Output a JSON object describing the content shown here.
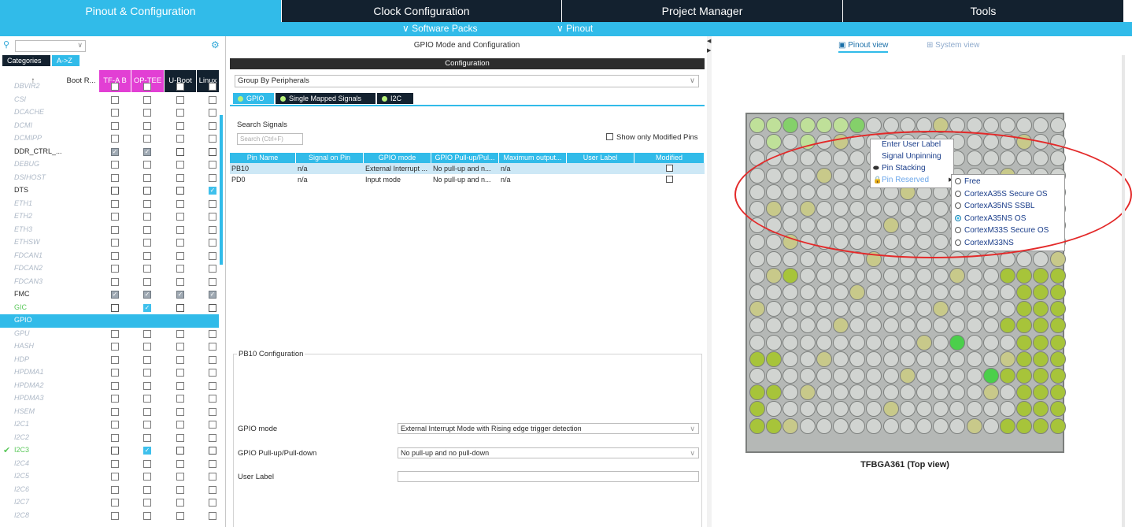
{
  "top_tabs": [
    "Pinout & Configuration",
    "Clock Configuration",
    "Project Manager",
    "Tools"
  ],
  "sub_menu": {
    "software_packs": "Software Packs",
    "pinout": "Pinout"
  },
  "left": {
    "category_tabs": [
      "Categories",
      "A->Z"
    ],
    "columns": [
      "Boot R...",
      "TF-A B",
      "OP-TEE",
      "U-Boot",
      "Linux"
    ],
    "rows": [
      {
        "name": "DBVIR2",
        "enabled": false,
        "checks": [
          "off",
          "off",
          "off",
          "off"
        ]
      },
      {
        "name": "CSI",
        "enabled": false,
        "checks": [
          "off",
          "off",
          "off",
          "off"
        ]
      },
      {
        "name": "DCACHE",
        "enabled": false,
        "checks": [
          "off",
          "off",
          "off",
          "off"
        ]
      },
      {
        "name": "DCMI",
        "enabled": false,
        "checks": [
          "off",
          "off",
          "off",
          "off"
        ]
      },
      {
        "name": "DCMIPP",
        "enabled": false,
        "checks": [
          "off",
          "off",
          "off",
          "off"
        ]
      },
      {
        "name": "DDR_CTRL_...",
        "enabled": true,
        "checks": [
          "on",
          "on",
          "off",
          "off"
        ]
      },
      {
        "name": "DEBUG",
        "enabled": false,
        "checks": [
          "off",
          "off",
          "off",
          "off"
        ]
      },
      {
        "name": "DSIHOST",
        "enabled": false,
        "checks": [
          "off",
          "off",
          "off",
          "off"
        ]
      },
      {
        "name": "DTS",
        "enabled": true,
        "checks": [
          "off",
          "off",
          "off",
          "blue"
        ]
      },
      {
        "name": "ETH1",
        "enabled": false,
        "checks": [
          "off",
          "off",
          "off",
          "off"
        ]
      },
      {
        "name": "ETH2",
        "enabled": false,
        "checks": [
          "off",
          "off",
          "off",
          "off"
        ]
      },
      {
        "name": "ETH3",
        "enabled": false,
        "checks": [
          "off",
          "off",
          "off",
          "off"
        ]
      },
      {
        "name": "ETHSW",
        "enabled": false,
        "checks": [
          "off",
          "off",
          "off",
          "off"
        ]
      },
      {
        "name": "FDCAN1",
        "enabled": false,
        "checks": [
          "off",
          "off",
          "off",
          "off"
        ]
      },
      {
        "name": "FDCAN2",
        "enabled": false,
        "checks": [
          "off",
          "off",
          "off",
          "off"
        ]
      },
      {
        "name": "FDCAN3",
        "enabled": false,
        "checks": [
          "off",
          "off",
          "off",
          "off"
        ]
      },
      {
        "name": "FMC",
        "enabled": true,
        "checks": [
          "on",
          "on",
          "on",
          "on"
        ]
      },
      {
        "name": "GIC",
        "enabled": true,
        "green": true,
        "checks": [
          "off",
          "blue",
          "off",
          "off"
        ]
      },
      {
        "name": "GPIO",
        "enabled": true,
        "selected": true,
        "checks": [
          "none",
          "none",
          "none",
          "none"
        ]
      },
      {
        "name": "GPU",
        "enabled": false,
        "checks": [
          "off",
          "off",
          "off",
          "off"
        ]
      },
      {
        "name": "HASH",
        "enabled": false,
        "checks": [
          "off",
          "off",
          "off",
          "off"
        ]
      },
      {
        "name": "HDP",
        "enabled": false,
        "checks": [
          "off",
          "off",
          "off",
          "off"
        ]
      },
      {
        "name": "HPDMA1",
        "enabled": false,
        "checks": [
          "off",
          "off",
          "off",
          "off"
        ]
      },
      {
        "name": "HPDMA2",
        "enabled": false,
        "checks": [
          "off",
          "off",
          "off",
          "off"
        ]
      },
      {
        "name": "HPDMA3",
        "enabled": false,
        "checks": [
          "off",
          "off",
          "off",
          "off"
        ]
      },
      {
        "name": "HSEM",
        "enabled": false,
        "checks": [
          "off",
          "off",
          "off",
          "off"
        ]
      },
      {
        "name": "I2C1",
        "enabled": false,
        "checks": [
          "off",
          "off",
          "off",
          "off"
        ]
      },
      {
        "name": "I2C2",
        "enabled": false,
        "checks": [
          "off",
          "off",
          "off",
          "off"
        ]
      },
      {
        "name": "I2C3",
        "enabled": true,
        "green": true,
        "tick": true,
        "checks": [
          "off",
          "blue",
          "off",
          "off"
        ]
      },
      {
        "name": "I2C4",
        "enabled": false,
        "checks": [
          "off",
          "off",
          "off",
          "off"
        ]
      },
      {
        "name": "I2C5",
        "enabled": false,
        "checks": [
          "off",
          "off",
          "off",
          "off"
        ]
      },
      {
        "name": "I2C6",
        "enabled": false,
        "checks": [
          "off",
          "off",
          "off",
          "off"
        ]
      },
      {
        "name": "I2C7",
        "enabled": false,
        "checks": [
          "off",
          "off",
          "off",
          "off"
        ]
      },
      {
        "name": "I2C8",
        "enabled": false,
        "checks": [
          "off",
          "off",
          "off",
          "off"
        ]
      }
    ]
  },
  "middle": {
    "title": "GPIO Mode and Configuration",
    "config_header": "Configuration",
    "group_by": "Group By Peripherals",
    "tabs": [
      "GPIO",
      "Single Mapped Signals",
      "I2C"
    ],
    "search_label": "Search Signals",
    "search_placeholder": "Search (Ctrl+F)",
    "show_modified": "Show only Modified Pins",
    "table_headers": [
      "Pin Name",
      "Signal on Pin",
      "GPIO mode",
      "GPIO Pull-up/Pul...",
      "Maximum output...",
      "User Label",
      "Modified"
    ],
    "table_rows": [
      [
        "PB10",
        "n/a",
        "External Interrupt ...",
        "No pull-up and n...",
        "n/a",
        "",
        ""
      ],
      [
        "PD0",
        "n/a",
        "Input mode",
        "No pull-up and n...",
        "n/a",
        "",
        ""
      ]
    ],
    "pin_config_title": "PB10 Configuration",
    "fields": [
      {
        "label": "GPIO mode",
        "value": "External Interrupt Mode with Rising edge trigger detection"
      },
      {
        "label": "GPIO Pull-up/Pull-down",
        "value": "No pull-up and no pull-down"
      },
      {
        "label": "User Label",
        "value": ""
      }
    ]
  },
  "right": {
    "view_tabs": [
      "Pinout view",
      "System view"
    ],
    "chip_label": "TFBGA361 (Top view)",
    "context_menu": [
      "Enter User Label",
      "Signal Unpinning",
      "Pin Stacking",
      "Pin Reserved"
    ],
    "submenu": [
      {
        "label": "Free",
        "selected": false
      },
      {
        "label": "CortexA35S Secure OS",
        "selected": false
      },
      {
        "label": "CortexA35NS SSBL",
        "selected": false
      },
      {
        "label": "CortexA35NS OS",
        "selected": true
      },
      {
        "label": "CortexM33S Secure OS",
        "selected": false
      },
      {
        "label": "CortexM33NS",
        "selected": false
      }
    ],
    "colors": {
      "accent": "#31bbe9",
      "dark": "#13212f",
      "highlight_oval": "#e32929"
    }
  }
}
